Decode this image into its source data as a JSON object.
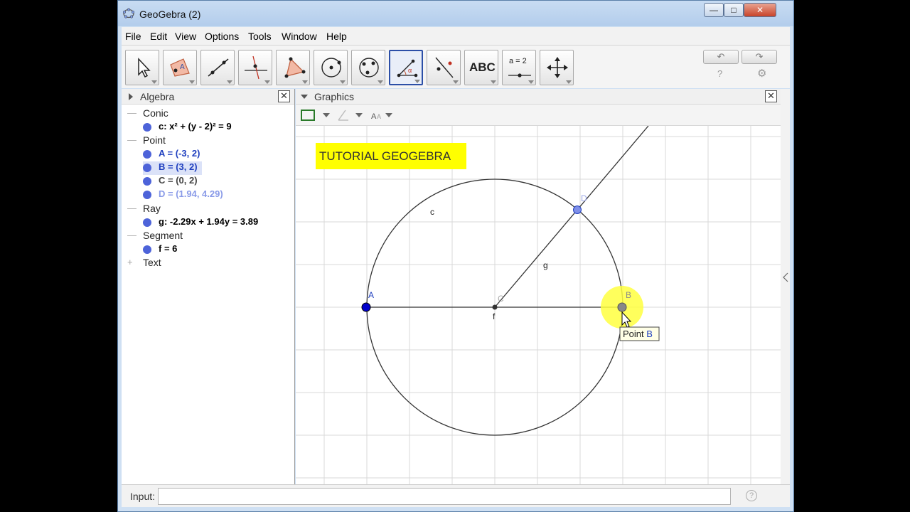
{
  "window": {
    "title": "GeoGebra (2)"
  },
  "menu": [
    "File",
    "Edit",
    "View",
    "Options",
    "Tools",
    "Window",
    "Help"
  ],
  "toolbar": {
    "text_tool_label": "ABC",
    "slider_tool_label": "a = 2",
    "selected_tool": "Polygon"
  },
  "algebra": {
    "title": "Algebra",
    "categories": [
      {
        "label": "Conic",
        "items": [
          {
            "text": "c: x² + (y - 2)² = 9",
            "color": "#000000"
          }
        ]
      },
      {
        "label": "Point",
        "items": [
          {
            "text": "A = (-3, 2)",
            "color": "#1f3fbf"
          },
          {
            "text": "B = (3, 2)",
            "color": "#1f3fbf",
            "highlighted": true
          },
          {
            "text": "C = (0, 2)",
            "color": "#444444"
          },
          {
            "text": "D = (1.94, 4.29)",
            "color": "#8a9be8"
          }
        ]
      },
      {
        "label": "Ray",
        "items": [
          {
            "text": "g: -2.29x + 1.94y = 3.89",
            "color": "#000000"
          }
        ]
      },
      {
        "label": "Segment",
        "items": [
          {
            "text": "f = 6",
            "color": "#000000"
          }
        ]
      },
      {
        "label": "Text",
        "items": []
      }
    ]
  },
  "graphics": {
    "title": "Graphics",
    "tutorial_text": "TUTORIAL GEOGEBRA",
    "tooltip_prefix": "Point ",
    "tooltip_name": "B",
    "labels": {
      "circle": "c",
      "ray": "g",
      "segment": "f",
      "point_a": "A",
      "point_b": "B",
      "point_c": "C",
      "point_d": "D"
    },
    "colors": {
      "highlight": "#ffff00",
      "point": "#0000cc",
      "point_light": "#7f8fe8",
      "grid": "#d8d8d8"
    }
  },
  "input": {
    "label": "Input:",
    "value": ""
  }
}
